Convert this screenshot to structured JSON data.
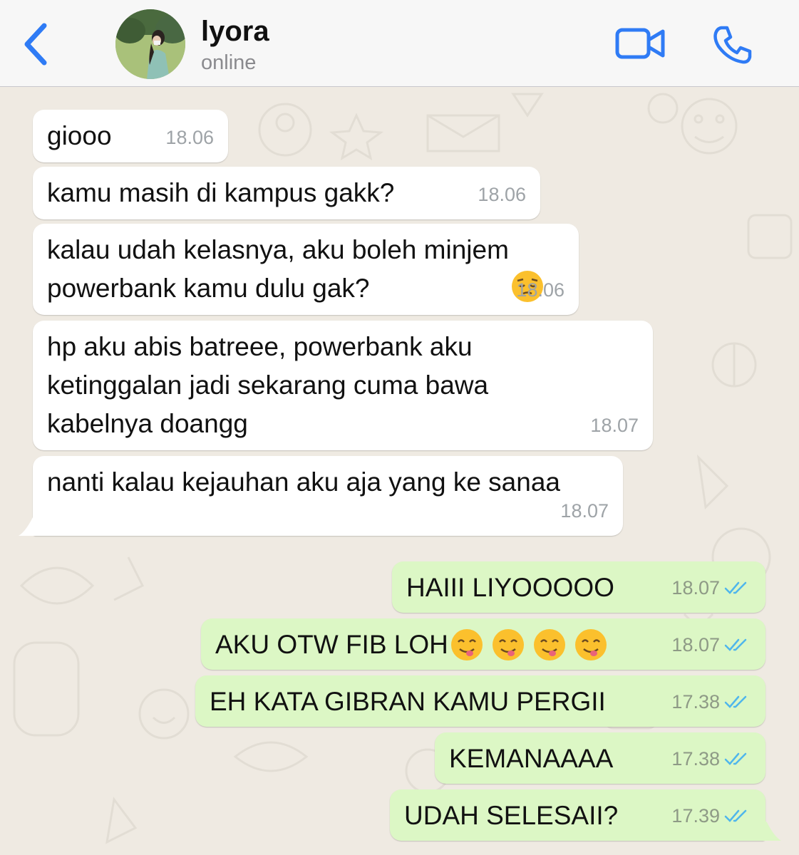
{
  "contact": {
    "name": "lyora",
    "status": "online"
  },
  "header_icons": {
    "back": "chevron-left-icon",
    "video": "video-camera-icon",
    "call": "phone-icon",
    "accent": "#2f7bf5"
  },
  "colors": {
    "incoming_bubble": "#ffffff",
    "outgoing_bubble": "#dcf7c5",
    "wallpaper": "#efeae2",
    "read_tick": "#4fb6ec"
  },
  "messages": [
    {
      "direction": "incoming",
      "text": "giooo",
      "time": "18.06"
    },
    {
      "direction": "incoming",
      "text": "kamu masih di kampus gakk?",
      "time": "18.06"
    },
    {
      "direction": "incoming",
      "text": "kalau udah kelasnya, aku boleh minjem\npowerbank kamu dulu gak?",
      "emoji": "pensive-face",
      "time": "18.06"
    },
    {
      "direction": "incoming",
      "text": "hp aku abis batreee, powerbank aku\nketinggalan jadi sekarang cuma bawa\nkabelnya doangg",
      "time": "18.07"
    },
    {
      "direction": "incoming",
      "text": "nanti kalau kejauhan aku aja yang ke sanaa",
      "time": "18.07"
    },
    {
      "direction": "outgoing",
      "text": "HAIII LIYOOOOO",
      "time": "18.07",
      "status": "read"
    },
    {
      "direction": "outgoing",
      "text": "AKU OTW FIB LOH",
      "emoji": "yum-face x4",
      "time": "18.07",
      "status": "read"
    },
    {
      "direction": "outgoing",
      "text": "EH KATA GIBRAN KAMU PERGII",
      "time": "17.38",
      "status": "read"
    },
    {
      "direction": "outgoing",
      "text": "KEMANAAAA",
      "time": "17.38",
      "status": "read"
    },
    {
      "direction": "outgoing",
      "text": "UDAH SELESAII?",
      "time": "17.39",
      "status": "read"
    }
  ]
}
